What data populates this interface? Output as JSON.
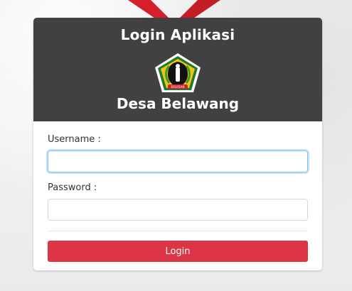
{
  "header": {
    "title": "Login Aplikasi",
    "subtitle": "Desa Belawang",
    "logo_icon": "regency-emblem-icon",
    "logo_text": "ERLOSAN"
  },
  "form": {
    "username_label": "Username :",
    "username_value": "",
    "password_label": "Password :",
    "password_value": "",
    "login_label": "Login"
  },
  "colors": {
    "header_bg": "#414141",
    "button_bg": "#dc3545",
    "focus_border": "#80bdff",
    "ribbon": "#d3202a"
  }
}
